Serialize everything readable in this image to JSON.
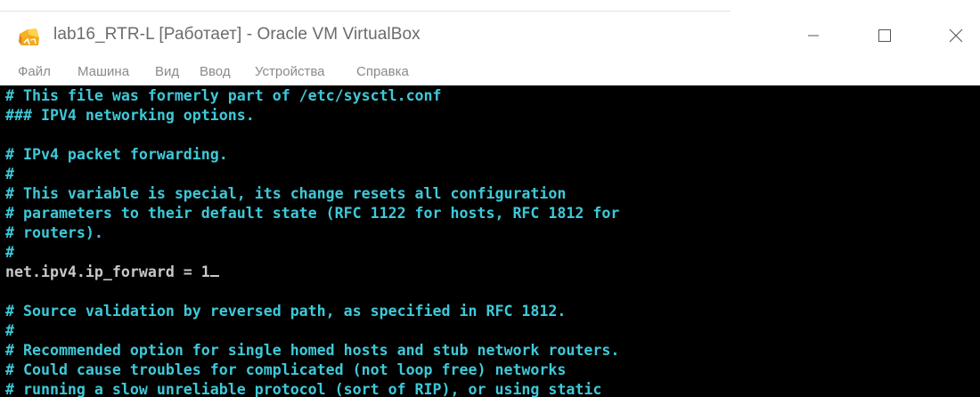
{
  "window": {
    "title": "lab16_RTR-L [Работает] - Oracle VM VirtualBox"
  },
  "menu": {
    "items": [
      "Файл",
      "Машина",
      "Вид",
      "Ввод",
      "Устройства",
      "Справка"
    ]
  },
  "terminal": {
    "lines": [
      "# This file was formerly part of /etc/sysctl.conf",
      "### IPV4 networking options.",
      "",
      "# IPv4 packet forwarding.",
      "#",
      "# This variable is special, its change resets all configuration",
      "# parameters to their default state (RFC 1122 for hosts, RFC 1812 for",
      "# routers).",
      "#",
      "net.ipv4.ip_forward = 1",
      "",
      "# Source validation by reversed path, as specified in RFC 1812.",
      "#",
      "# Recommended option for single homed hosts and stub network routers.",
      "# Could cause troubles for complicated (not loop free) networks",
      "# running a slow unreliable protocol (sort of RIP), or using static"
    ]
  },
  "colors": {
    "terminal_text": "#3ec9d8",
    "terminal_setting": "#c8c8c8",
    "terminal_background": "#000000"
  },
  "icons": {
    "app": "virtualbox-app-icon",
    "minimize": "minimize-icon",
    "maximize": "maximize-icon",
    "close": "close-icon"
  }
}
